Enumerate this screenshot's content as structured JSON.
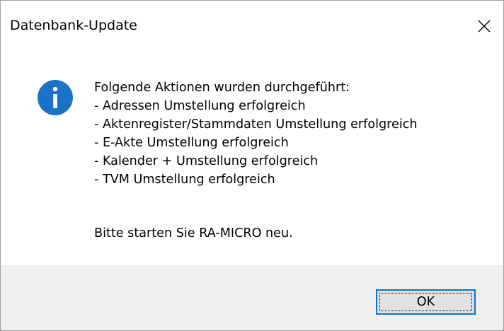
{
  "window": {
    "title": "Datenbank-Update"
  },
  "icons": {
    "info": "info-icon",
    "close": "close-icon"
  },
  "colors": {
    "info_icon": "#1a73c9",
    "accent": "#0078d7",
    "button_bg": "#e1e1e1",
    "footer_bg": "#f0f0f0"
  },
  "message": {
    "lines": [
      "Folgende Aktionen wurden durchgeführt:",
      "- Adressen Umstellung erfolgreich",
      "- Aktenregister/Stammdaten Umstellung erfolgreich",
      "- E-Akte Umstellung erfolgreich",
      "- Kalender + Umstellung erfolgreich",
      "- TVM Umstellung erfolgreich"
    ],
    "restart_notice": "Bitte starten Sie RA-MICRO neu."
  },
  "buttons": {
    "ok_label": "OK"
  }
}
